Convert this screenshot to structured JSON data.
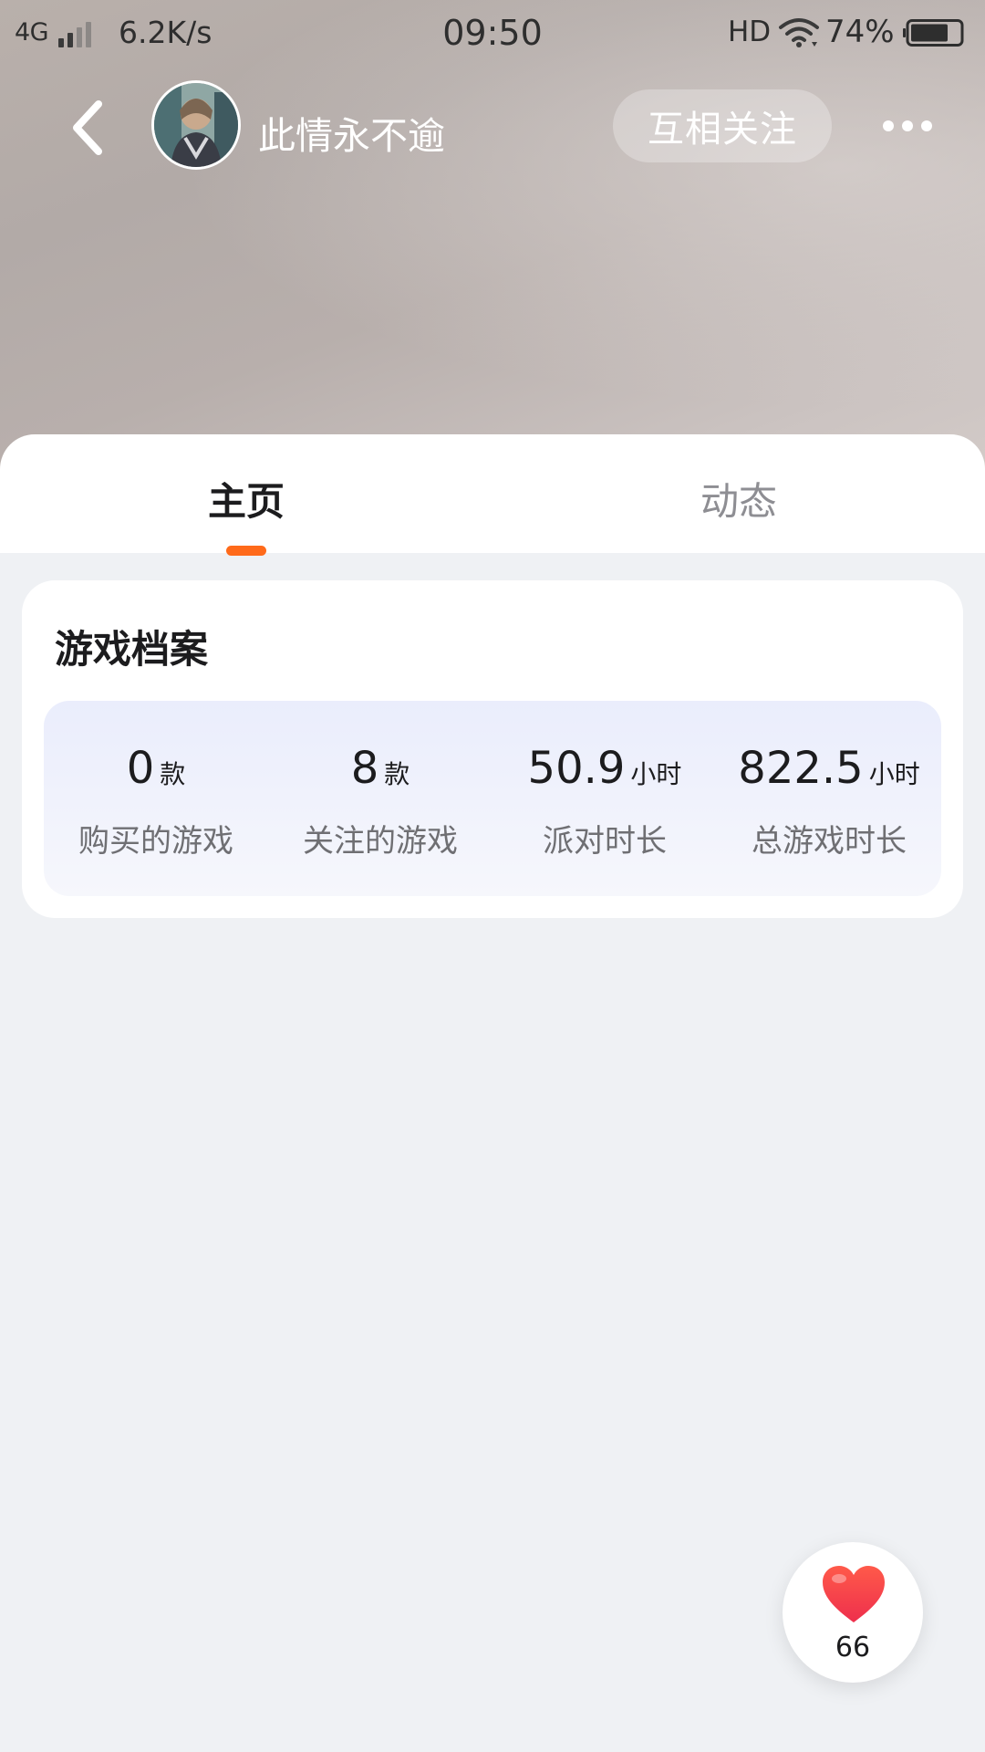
{
  "status_bar": {
    "network": "4G",
    "speed": "6.2K/s",
    "time": "09:50",
    "hd": "HD",
    "battery": "74%"
  },
  "profile": {
    "name": "此情永不逾",
    "follow_label": "互相关注"
  },
  "tabs": [
    {
      "label": "主页",
      "active": true
    },
    {
      "label": "动态",
      "active": false
    }
  ],
  "game_profile": {
    "title": "游戏档案",
    "stats": [
      {
        "value": "0",
        "unit": "款",
        "label": "购买的游戏"
      },
      {
        "value": "8",
        "unit": "款",
        "label": "关注的游戏"
      },
      {
        "value": "50.9",
        "unit": "小时",
        "label": "派对时长"
      },
      {
        "value": "822.5",
        "unit": "小时",
        "label": "总游戏时长"
      }
    ]
  },
  "like": {
    "count": "66"
  },
  "colors": {
    "accent": "#ff6a1a",
    "heart": "#f5413f",
    "background": "#eff1f4"
  },
  "icons": [
    "back-arrow-icon",
    "avatar",
    "more-dots-icon",
    "heart-icon",
    "wifi-icon",
    "signal-icon",
    "battery-icon"
  ]
}
